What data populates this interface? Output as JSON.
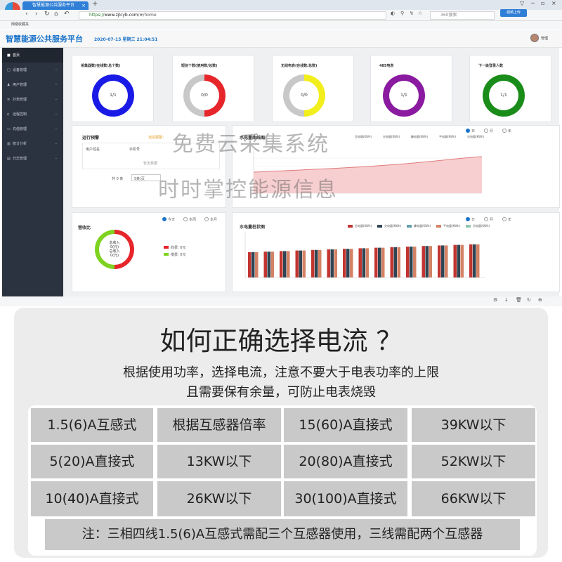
{
  "browser": {
    "tab_title": "智慧能源公共服务平台",
    "tab_close": "×",
    "new_tab": "+",
    "url_scheme": "https://",
    "url_host": "www.zjlcyb.com",
    "url_path": "/#/home",
    "search_placeholder": "360搜索",
    "badge": "视频上传",
    "bookmark": "网络收藏夹",
    "window_buttons": [
      "▽",
      "─",
      "▫",
      "×"
    ]
  },
  "app": {
    "title": "智慧能源公共服务平台",
    "datetime": "2020-07-15 星期三 21:04:51",
    "user": "管理"
  },
  "sidebar": {
    "items": [
      {
        "icon": "■",
        "label": "首页"
      },
      {
        "icon": "□",
        "label": "设备管理"
      },
      {
        "icon": "♟",
        "label": "用户管理"
      },
      {
        "icon": "≡",
        "label": "抄表管理"
      },
      {
        "icon": "¢",
        "label": "远程控制"
      },
      {
        "icon": "▭",
        "label": "充值管理"
      },
      {
        "icon": "▥",
        "label": "统计分析"
      },
      {
        "icon": "▤",
        "label": "日志管理"
      }
    ]
  },
  "stats": [
    {
      "title": "采集器数(在线数/总个数)",
      "value": "1/1",
      "color": "#1a1ae6",
      "track": "#1a1ae6",
      "fraction": 1.0
    },
    {
      "title": "短信个数(使用数/总数)",
      "value": "0/0",
      "color": "#e6262b",
      "track": "#c8c8c8",
      "fraction": 0.5
    },
    {
      "title": "无线电表(在线数/总数)",
      "value": "0/0",
      "color": "#f2ee1c",
      "track": "#c8c8c8",
      "fraction": 0.5
    },
    {
      "title": "485电表",
      "value": "1/1",
      "color": "#8a1aa0",
      "track": "#8a1aa0",
      "fraction": 1.0
    },
    {
      "title": "下一级登录人数",
      "value": "1/1",
      "color": "#1a8c1a",
      "track": "#1a8c1a",
      "fraction": 1.0
    }
  ],
  "alarm": {
    "title": "运行预警",
    "link": "当前报警：",
    "columns": [
      "用户姓名",
      "手机号",
      "…"
    ],
    "empty": "暂无数据",
    "pager_total": "共 0 条",
    "pager_size": "5条/页"
  },
  "curve": {
    "title": "水电量曲线图",
    "radios": [
      "日",
      "月",
      "年"
    ],
    "legend": [
      "总电量(KWh)",
      "尖电量(KWh)",
      "峰电量(KWh)",
      "平电量(KWh)",
      "谷电量(KWh)"
    ]
  },
  "revenue": {
    "title": "营收比",
    "radios": [
      "今天",
      "本周",
      "本月"
    ],
    "center_lines": [
      "总收入",
      "0(元)",
      "总收入",
      "0(元)"
    ],
    "legend": [
      {
        "label": "收费: 0元",
        "color": "#e6262b"
      },
      {
        "label": "缴费: 0元",
        "color": "#7ed321"
      }
    ]
  },
  "columns_chart": {
    "title": "水电量柱状图",
    "radios": [
      "日",
      "月",
      "年"
    ],
    "legend": [
      "总电量(KWh)",
      "尖电量(KWh)",
      "峰电量(KWh)",
      "平电量(KWh)",
      "谷电量(KWh)"
    ]
  },
  "watermark": {
    "line1": "免费云采集系统",
    "line2": "时时掌控能源信息"
  },
  "info": {
    "title": "如何正确选择电流 ？",
    "sub1": "根据使用功率，选择电流，注意不要大于电表功率的上限",
    "sub2": "且需要保有余量，可防止电表烧毁",
    "rows": [
      [
        "1.5(6)A互感式",
        "根据互感器倍率",
        "15(60)A直接式",
        "39KW以下"
      ],
      [
        "5(20)A直接式",
        "13KW以下",
        "20(80)A直接式",
        "52KW以下"
      ],
      [
        "10(40)A直接式",
        "26KW以下",
        "30(100)A直接式",
        "66KW以下"
      ]
    ],
    "note": "注：三相四线1.5(6)A互感式需配三个互感器使用，三线需配两个互感器"
  }
}
